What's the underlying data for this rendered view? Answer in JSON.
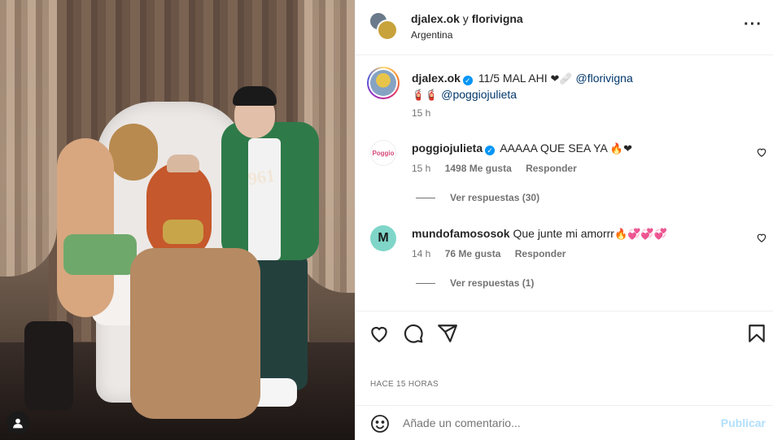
{
  "post": {
    "header": {
      "author1": "djalex.ok",
      "joiner": " y ",
      "author2": "florivigna",
      "location": "Argentina",
      "more_icon": "more-horizontal-icon"
    },
    "caption": {
      "username": "djalex.ok",
      "text": "11/5 MAL AHI",
      "emojis_a": "❤🩹",
      "mention1": "@florivigna",
      "emojis_b": "🧯🧯",
      "mention2": "@poggiojulieta",
      "time": "15 h"
    },
    "comments": [
      {
        "username": "poggiojulieta",
        "verified": true,
        "text": "AAAAA QUE SEA YA",
        "emojis": "🔥❤",
        "time": "15 h",
        "likes": "1498 Me gusta",
        "reply": "Responder",
        "view_replies": "Ver respuestas (30)",
        "avatar_text": "Poggio"
      },
      {
        "username": "mundofamososok",
        "verified": false,
        "text": "Que junte mi amorrr",
        "emojis": "🔥💞💞💞",
        "time": "14 h",
        "likes": "76 Me gusta",
        "reply": "Responder",
        "view_replies": "Ver respuestas (1)",
        "avatar_text": "M"
      }
    ],
    "time_ago": "HACE 15 HORAS",
    "composer": {
      "placeholder": "Añade un comentario...",
      "publish": "Publicar"
    },
    "photo": {
      "jacket_text": "961"
    }
  },
  "colors": {
    "accent": "#0095f6",
    "mention": "#00376b",
    "muted": "#737373",
    "publish_disabled": "#b2dffc"
  }
}
